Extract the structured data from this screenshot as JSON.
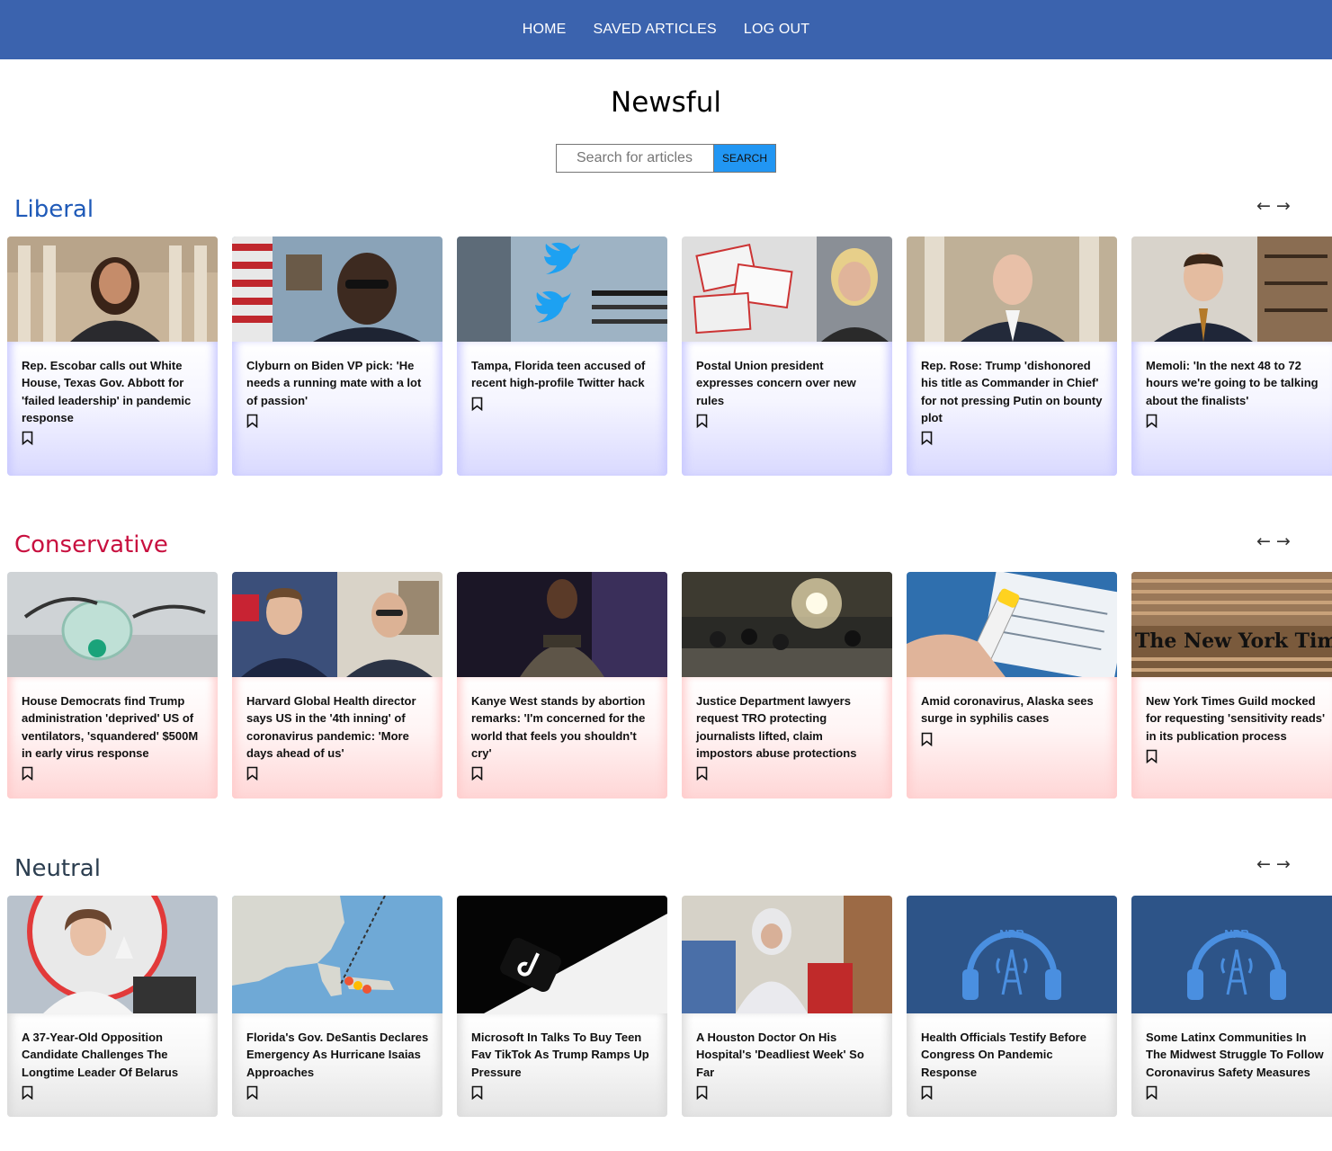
{
  "nav": {
    "home_label": "HOME",
    "saved_label": "SAVED ARTICLES",
    "logout_label": "LOG OUT"
  },
  "site": {
    "title": "Newsful"
  },
  "search": {
    "placeholder": "Search for articles",
    "button_label": "SEARCH"
  },
  "colors": {
    "navbar": "#3b63ae",
    "search_button": "#2196f3",
    "liberal_heading": "#1f5ab8",
    "conservative_heading": "#c8103f",
    "neutral_heading": "#2c3e50"
  },
  "sections": [
    {
      "heading": "Liberal",
      "arrow_left_icon": "arrow-left-icon",
      "arrow_right_icon": "arrow-right-icon",
      "cards": [
        {
          "title": "Rep. Escobar calls out White House, Texas Gov. Abbott for 'failed leadership' in pandemic response",
          "image": "woman-in-capitol-hallway"
        },
        {
          "title": "Clyburn on Biden VP pick: 'He needs a running mate with a lot of passion'",
          "image": "man-with-glasses-and-flag"
        },
        {
          "title": "Tampa, Florida teen accused of recent high-profile Twitter hack",
          "image": "twitter-logo-screen"
        },
        {
          "title": "Postal Union president expresses concern over new rules",
          "image": "mail-ballots-and-woman"
        },
        {
          "title": "Rep. Rose: Trump 'dishonored his title as Commander in Chief' for not pressing Putin on bounty plot",
          "image": "man-in-capitol-columns"
        },
        {
          "title": "Memoli: 'In the next 48 to 72 hours we're going to be talking about the finalists'",
          "image": "man-in-home-office"
        }
      ]
    },
    {
      "heading": "Conservative",
      "arrow_left_icon": "arrow-left-icon",
      "arrow_right_icon": "arrow-right-icon",
      "cards": [
        {
          "title": "House Democrats find Trump administration 'deprived' US of ventilators, 'squandered' $500M in early virus response",
          "image": "oxygen-mask"
        },
        {
          "title": "Harvard Global Health director says US in the '4th inning' of coronavirus pandemic: 'More days ahead of us'",
          "image": "news-anchor-and-guest"
        },
        {
          "title": "Kanye West stands by abortion remarks: 'I'm concerned for the world that feels you shouldn't cry'",
          "image": "man-in-security-vest"
        },
        {
          "title": "Justice Department lawyers request TRO protecting journalists lifted, claim impostors abuse protections",
          "image": "protest-fireworks"
        },
        {
          "title": "Amid coronavirus, Alaska sees surge in syphilis cases",
          "image": "test-tube-and-form"
        },
        {
          "title": "New York Times Guild mocked for requesting 'sensitivity reads' in its publication process",
          "image": "new-york-times-building",
          "image_text": "The New York Times"
        }
      ]
    },
    {
      "heading": "Neutral",
      "arrow_left_icon": "arrow-left-icon",
      "arrow_right_icon": "arrow-right-icon",
      "cards": [
        {
          "title": "A 37-Year-Old Opposition Candidate Challenges The Longtime Leader Of Belarus",
          "image": "woman-at-rally"
        },
        {
          "title": "Florida's Gov. DeSantis Declares Emergency As Hurricane Isaias Approaches",
          "image": "hurricane-track-map"
        },
        {
          "title": "Microsoft In Talks To Buy Teen Fav TikTok As Trump Ramps Up Pressure",
          "image": "tiktok-logo-phone"
        },
        {
          "title": "A Houston Doctor On His Hospital's 'Deadliest Week' So Far",
          "image": "doctor-in-protective-suit"
        },
        {
          "title": "Health Officials Testify Before Congress On Pandemic Response",
          "image": "npr-headphones-logo",
          "image_text": "NPR"
        },
        {
          "title": "Some Latinx Communities In The Midwest Struggle To Follow Coronavirus Safety Measures",
          "image": "npr-headphones-logo",
          "image_text": "NPR"
        }
      ]
    }
  ]
}
